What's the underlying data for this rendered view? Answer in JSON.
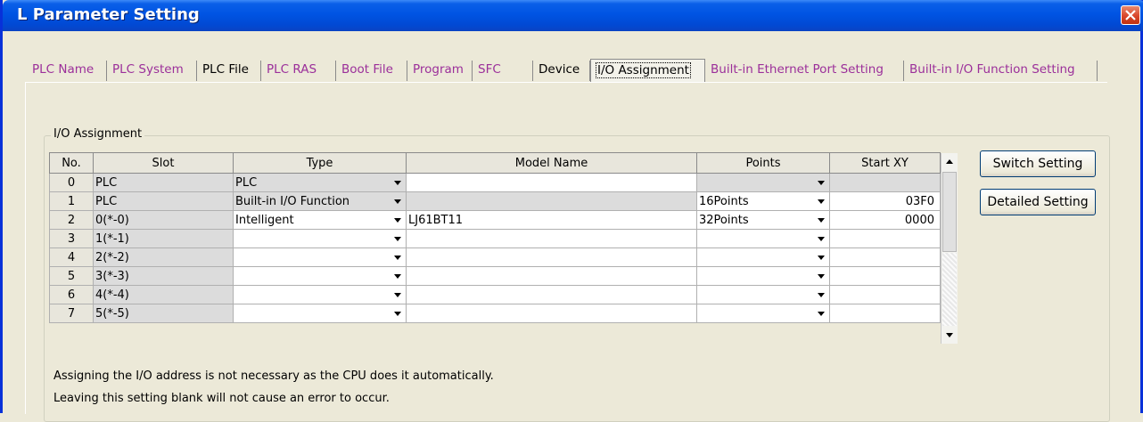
{
  "window": {
    "title": "L Parameter Setting"
  },
  "tabs": [
    {
      "label": "PLC Name"
    },
    {
      "label": "PLC System"
    },
    {
      "label": "PLC File"
    },
    {
      "label": "PLC RAS"
    },
    {
      "label": "Boot File"
    },
    {
      "label": "Program"
    },
    {
      "label": "SFC"
    },
    {
      "label": "Device"
    },
    {
      "label": "I/O Assignment"
    },
    {
      "label": "Built-in Ethernet Port Setting"
    },
    {
      "label": "Built-in I/O Function Setting"
    }
  ],
  "active_tab": "I/O Assignment",
  "group": {
    "label": "I/O Assignment"
  },
  "table": {
    "columns": [
      "No.",
      "Slot",
      "Type",
      "Model Name",
      "Points",
      "Start XY"
    ],
    "rows": [
      {
        "no": "0",
        "slot": "PLC",
        "type": "PLC",
        "model": "",
        "points": "",
        "start": ""
      },
      {
        "no": "1",
        "slot": "PLC",
        "type": "Built-in I/O Function",
        "model": "",
        "points": "16Points",
        "start": "03F0"
      },
      {
        "no": "2",
        "slot": "0(*-0)",
        "type": "Intelligent",
        "model": "LJ61BT11",
        "points": "32Points",
        "start": "0000"
      },
      {
        "no": "3",
        "slot": "1(*-1)",
        "type": "",
        "model": "",
        "points": "",
        "start": ""
      },
      {
        "no": "4",
        "slot": "2(*-2)",
        "type": "",
        "model": "",
        "points": "",
        "start": ""
      },
      {
        "no": "5",
        "slot": "3(*-3)",
        "type": "",
        "model": "",
        "points": "",
        "start": ""
      },
      {
        "no": "6",
        "slot": "4(*-4)",
        "type": "",
        "model": "",
        "points": "",
        "start": ""
      },
      {
        "no": "7",
        "slot": "5(*-5)",
        "type": "",
        "model": "",
        "points": "",
        "start": ""
      }
    ]
  },
  "buttons": {
    "switch_setting": "Switch Setting",
    "detailed_setting": "Detailed Setting"
  },
  "notes": {
    "line1": "Assigning the I/O address is not necessary as the CPU does it automatically.",
    "line2": "Leaving this setting blank will not cause an error to occur."
  }
}
